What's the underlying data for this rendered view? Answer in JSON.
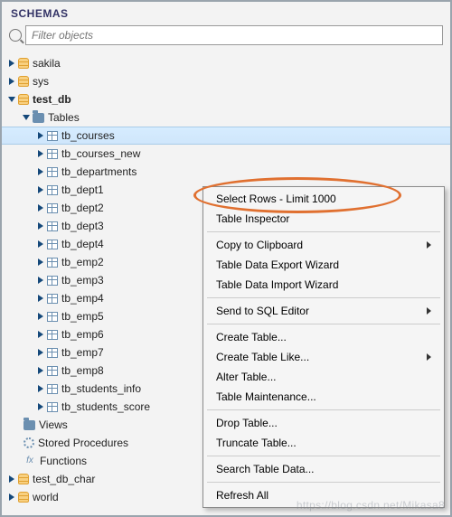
{
  "header": {
    "title": "SCHEMAS"
  },
  "filter": {
    "placeholder": "Filter objects"
  },
  "tree": {
    "schemas": [
      {
        "name": "sakila",
        "expanded": false
      },
      {
        "name": "sys",
        "expanded": false
      },
      {
        "name": "test_db",
        "expanded": true,
        "bold": true,
        "children": [
          {
            "name": "Tables",
            "type": "folder",
            "expanded": true,
            "items": [
              "tb_courses",
              "tb_courses_new",
              "tb_departments",
              "tb_dept1",
              "tb_dept2",
              "tb_dept3",
              "tb_dept4",
              "tb_emp2",
              "tb_emp3",
              "tb_emp4",
              "tb_emp5",
              "tb_emp6",
              "tb_emp7",
              "tb_emp8",
              "tb_students_info",
              "tb_students_score"
            ],
            "selected": "tb_courses"
          },
          {
            "name": "Views",
            "type": "folder"
          },
          {
            "name": "Stored Procedures",
            "type": "folder-gear"
          },
          {
            "name": "Functions",
            "type": "fx"
          }
        ]
      },
      {
        "name": "test_db_char",
        "expanded": false
      },
      {
        "name": "world",
        "expanded": false
      }
    ]
  },
  "context_menu": {
    "items": [
      {
        "label": "Select Rows - Limit 1000",
        "highlighted": true
      },
      {
        "label": "Table Inspector"
      },
      {
        "sep": true
      },
      {
        "label": "Copy to Clipboard",
        "submenu": true
      },
      {
        "label": "Table Data Export Wizard"
      },
      {
        "label": "Table Data Import Wizard"
      },
      {
        "sep": true
      },
      {
        "label": "Send to SQL Editor",
        "submenu": true
      },
      {
        "sep": true
      },
      {
        "label": "Create Table..."
      },
      {
        "label": "Create Table Like...",
        "submenu": true
      },
      {
        "label": "Alter Table..."
      },
      {
        "label": "Table Maintenance..."
      },
      {
        "sep": true
      },
      {
        "label": "Drop Table..."
      },
      {
        "label": "Truncate Table..."
      },
      {
        "sep": true
      },
      {
        "label": "Search Table Data..."
      },
      {
        "sep": true
      },
      {
        "label": "Refresh All"
      }
    ]
  },
  "watermark": "https://blog.csdn.net/Mikasa8"
}
